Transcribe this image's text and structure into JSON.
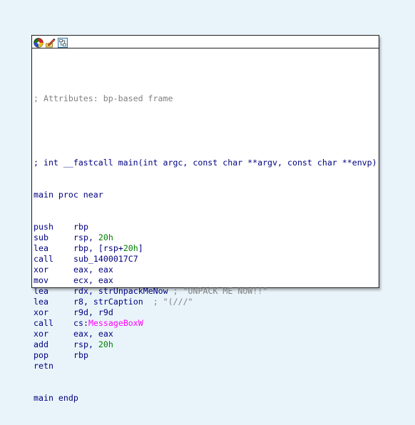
{
  "toolbar": {
    "icons": [
      "color-palette-icon",
      "edit-pencil-icon",
      "graph-view-icon"
    ]
  },
  "code": {
    "attributes_comment": "; Attributes: bp-based frame",
    "signature_comment": "; int __fastcall main(int argc, const char **argv, const char **envp)",
    "proc_start": "main proc near",
    "instructions": [
      {
        "mnem": "push",
        "ops": [
          {
            "t": "rbp",
            "c": "op"
          }
        ]
      },
      {
        "mnem": "sub",
        "ops": [
          {
            "t": "rsp, ",
            "c": "op"
          },
          {
            "t": "20h",
            "c": "num"
          }
        ]
      },
      {
        "mnem": "lea",
        "ops": [
          {
            "t": "rbp, [rsp+",
            "c": "op"
          },
          {
            "t": "20h",
            "c": "num"
          },
          {
            "t": "]",
            "c": "op"
          }
        ]
      },
      {
        "mnem": "call",
        "ops": [
          {
            "t": "sub_1400017C7",
            "c": "op"
          }
        ]
      },
      {
        "mnem": "xor",
        "ops": [
          {
            "t": "eax, eax",
            "c": "op"
          }
        ]
      },
      {
        "mnem": "mov",
        "ops": [
          {
            "t": "ecx, eax",
            "c": "op"
          }
        ]
      },
      {
        "mnem": "lea",
        "ops": [
          {
            "t": "rdx, strUnpackMeNow",
            "c": "op"
          },
          {
            "t": " ; \"UNPACK ME NOW!!\"",
            "c": "str"
          }
        ]
      },
      {
        "mnem": "lea",
        "ops": [
          {
            "t": "r8, strCaption",
            "c": "op"
          },
          {
            "t": "  ; \"(///\"",
            "c": "str"
          }
        ]
      },
      {
        "mnem": "xor",
        "ops": [
          {
            "t": "r9d, r9d",
            "c": "op"
          }
        ]
      },
      {
        "mnem": "call",
        "ops": [
          {
            "t": "cs:",
            "c": "op"
          },
          {
            "t": "MessageBoxW",
            "c": "ext"
          }
        ]
      },
      {
        "mnem": "xor",
        "ops": [
          {
            "t": "eax, eax",
            "c": "op"
          }
        ]
      },
      {
        "mnem": "add",
        "ops": [
          {
            "t": "rsp, ",
            "c": "op"
          },
          {
            "t": "20h",
            "c": "num"
          }
        ]
      },
      {
        "mnem": "pop",
        "ops": [
          {
            "t": "rbp",
            "c": "op"
          }
        ]
      },
      {
        "mnem": "retn",
        "ops": []
      }
    ],
    "proc_end": "main endp"
  },
  "colors": {
    "background": "#e9f4fa",
    "code": "#000080",
    "comment": "#808080",
    "number": "#008000",
    "extern": "#ff00ff"
  }
}
